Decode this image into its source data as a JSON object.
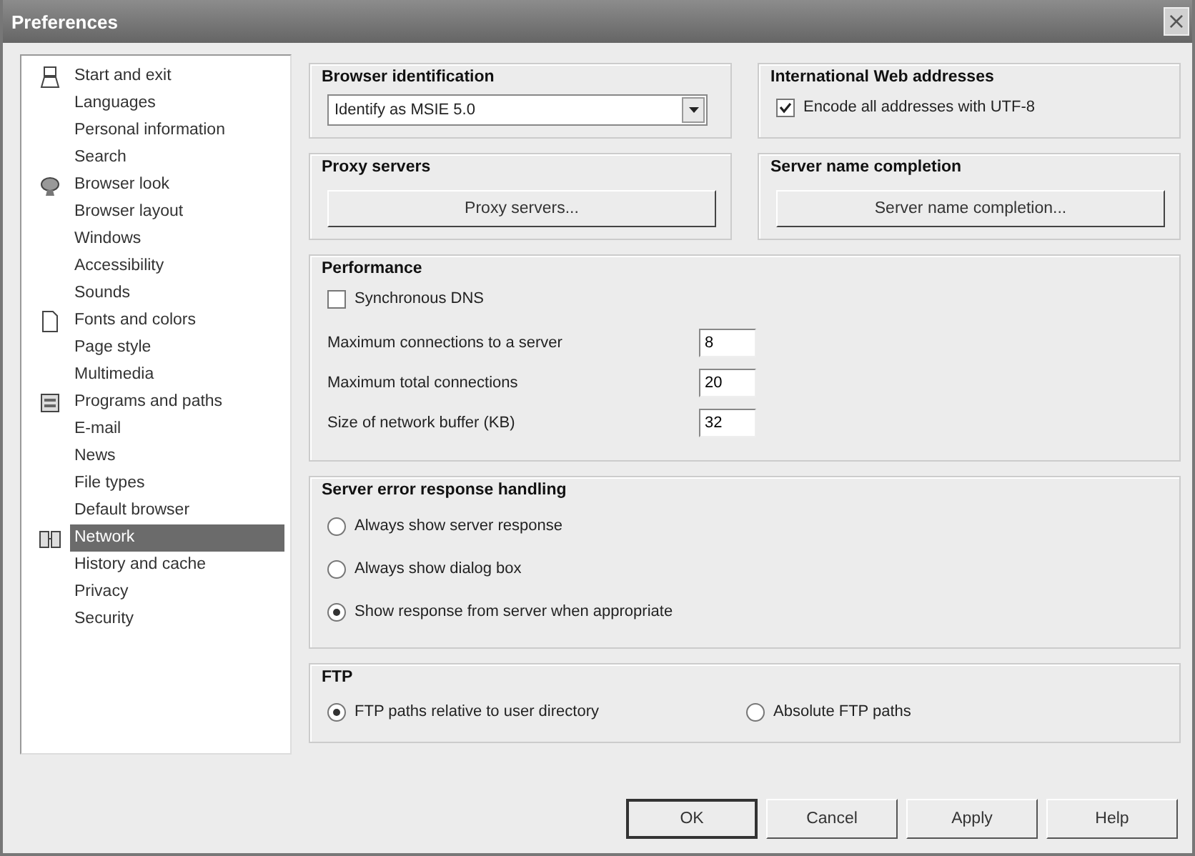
{
  "window": {
    "title": "Preferences",
    "close": "×"
  },
  "sidebar": {
    "groups": [
      {
        "items": [
          {
            "label": "Start and exit",
            "selected": false
          },
          {
            "label": "Languages",
            "selected": false
          },
          {
            "label": "Personal information",
            "selected": false
          },
          {
            "label": "Search",
            "selected": false
          }
        ]
      },
      {
        "items": [
          {
            "label": "Browser look",
            "selected": false
          },
          {
            "label": "Browser layout",
            "selected": false
          },
          {
            "label": "Windows",
            "selected": false
          },
          {
            "label": "Accessibility",
            "selected": false
          },
          {
            "label": "Sounds",
            "selected": false
          }
        ]
      },
      {
        "items": [
          {
            "label": "Fonts and colors",
            "selected": false
          },
          {
            "label": "Page style",
            "selected": false
          },
          {
            "label": "Multimedia",
            "selected": false
          }
        ]
      },
      {
        "items": [
          {
            "label": "Programs and paths",
            "selected": false
          },
          {
            "label": "E-mail",
            "selected": false
          },
          {
            "label": "News",
            "selected": false
          },
          {
            "label": "File types",
            "selected": false
          },
          {
            "label": "Default browser",
            "selected": false
          }
        ]
      },
      {
        "items": [
          {
            "label": "Network",
            "selected": true
          },
          {
            "label": "History and cache",
            "selected": false
          },
          {
            "label": "Privacy",
            "selected": false
          },
          {
            "label": "Security",
            "selected": false
          }
        ]
      }
    ]
  },
  "browser_identification": {
    "title": "Browser identification",
    "value": "Identify as MSIE 5.0"
  },
  "international_web_addresses": {
    "title": "International Web addresses",
    "checkbox": {
      "label": "Encode all addresses with UTF-8",
      "checked": true
    }
  },
  "proxy_servers": {
    "title": "Proxy servers",
    "button": "Proxy servers..."
  },
  "server_name_completion": {
    "title": "Server name completion",
    "button": "Server name completion..."
  },
  "performance": {
    "title": "Performance",
    "checkbox": {
      "label": "Synchronous DNS",
      "checked": false
    },
    "fields": [
      {
        "label": "Maximum connections to a server",
        "value": "8"
      },
      {
        "label": "Maximum total connections",
        "value": "20"
      },
      {
        "label": "Size of network buffer (KB)",
        "value": "32"
      }
    ]
  },
  "server_error_response_handling": {
    "title": "Server error response handling",
    "options": [
      {
        "label": "Always show server response",
        "selected": false
      },
      {
        "label": "Always show dialog box",
        "selected": false
      },
      {
        "label": "Show response from server when appropriate",
        "selected": true
      }
    ]
  },
  "ftp": {
    "title": "FTP",
    "options": [
      {
        "label": "FTP paths relative to user directory",
        "selected": true
      },
      {
        "label": "Absolute FTP paths",
        "selected": false
      }
    ]
  },
  "buttons": [
    {
      "label": "OK",
      "default": true
    },
    {
      "label": "Cancel",
      "default": false
    },
    {
      "label": "Apply",
      "default": false
    },
    {
      "label": "Help",
      "default": false
    }
  ]
}
